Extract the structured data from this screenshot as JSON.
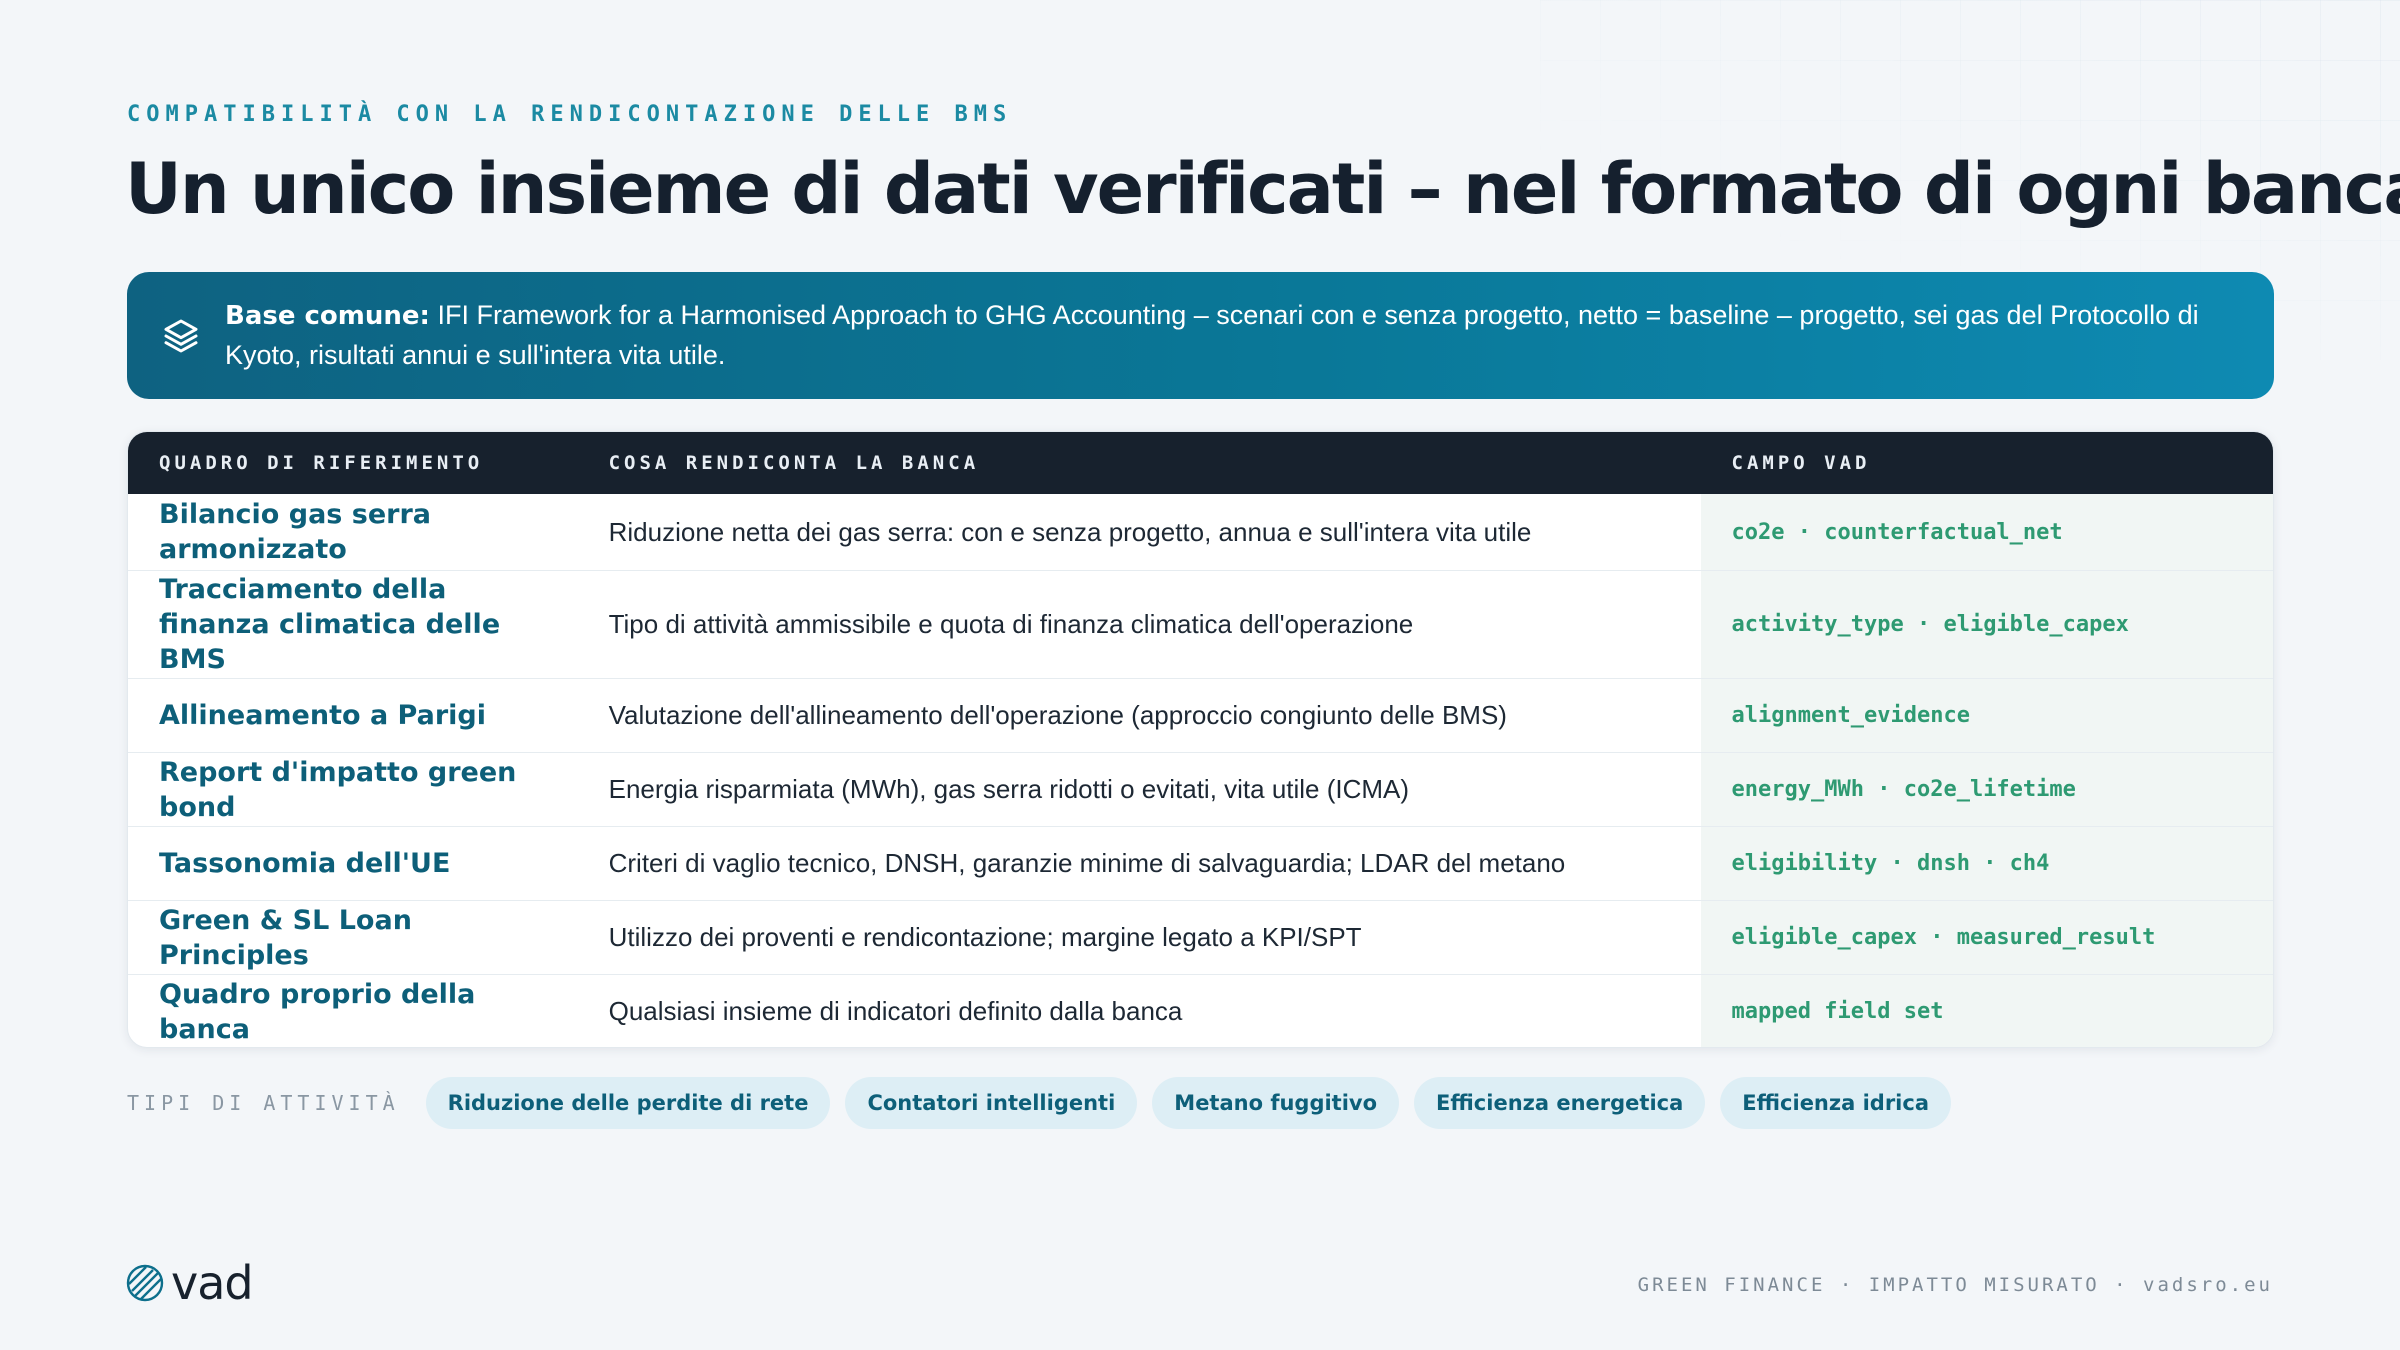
{
  "header": {
    "eyebrow": "COMPATIBILITÀ CON LA RENDICONTAZIONE DELLE BMS",
    "title": "Un unico insieme di dati verificati – nel formato di ogni banca"
  },
  "callout": {
    "icon": "layers-icon",
    "lead": "Base comune:",
    "text": " IFI Framework for a Harmonised Approach to GHG Accounting – scenari con e senza progetto, netto = baseline – progetto, sei gas del Protocollo di Kyoto, risultati annui e sull'intera vita utile."
  },
  "table": {
    "headers": [
      "QUADRO DI RIFERIMENTO",
      "COSA RENDICONTA LA BANCA",
      "CAMPO VAD"
    ],
    "rows": [
      {
        "framework": "Bilancio gas serra armonizzato",
        "reports": "Riduzione netta dei gas serra: con e senza progetto, annua e sull'intera vita utile",
        "field": "co2e · counterfactual_net"
      },
      {
        "framework": "Tracciamento della finanza climatica delle BMS",
        "reports": "Tipo di attività ammissibile e quota di finanza climatica dell'operazione",
        "field": "activity_type · eligible_capex"
      },
      {
        "framework": "Allineamento a Parigi",
        "reports": "Valutazione dell'allineamento dell'operazione (approccio congiunto delle BMS)",
        "field": "alignment_evidence"
      },
      {
        "framework": "Report d'impatto green bond",
        "reports": "Energia risparmiata (MWh), gas serra ridotti o evitati, vita utile (ICMA)",
        "field": "energy_MWh · co2e_lifetime"
      },
      {
        "framework": "Tassonomia dell'UE",
        "reports": "Criteri di vaglio tecnico, DNSH, garanzie minime di salvaguardia; LDAR del metano",
        "field": "eligibility · dnsh · ch4"
      },
      {
        "framework": "Green & SL Loan Principles",
        "reports": "Utilizzo dei proventi e rendicontazione; margine legato a KPI/SPT",
        "field": "eligible_capex · measured_result"
      },
      {
        "framework": "Quadro proprio della banca",
        "reports": "Qualsiasi insieme di indicatori definito dalla banca",
        "field": "mapped field set"
      }
    ]
  },
  "activity_types": {
    "label": "TIPI DI ATTIVITÀ",
    "tags": [
      "Riduzione delle perdite di rete",
      "Contatori intelligenti",
      "Metano fuggitivo",
      "Efficienza energetica",
      "Efficienza idrica"
    ]
  },
  "brand": {
    "logo_text": "vad",
    "logo_icon": "globe-logo-icon"
  },
  "footer": {
    "text": "GREEN FINANCE · IMPATTO MISURATO · vadsro.eu"
  },
  "colors": {
    "accent": "#1b8aa3",
    "brand_dark": "#17212d",
    "field_green": "#2e9a72",
    "callout_start": "#0e6281",
    "callout_end": "#0e8ab2"
  }
}
